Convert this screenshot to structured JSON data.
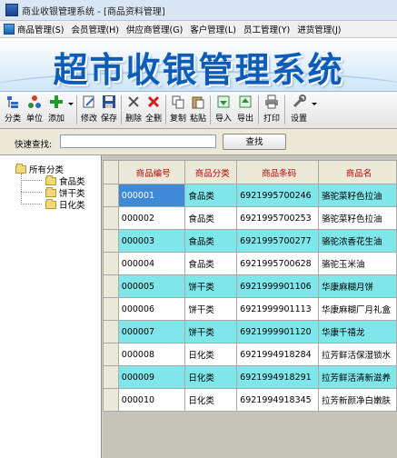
{
  "window": {
    "title": "商业收银管理系统 - [商品资料管理]"
  },
  "menu": [
    {
      "label": "商品管理(S)"
    },
    {
      "label": "会员管理(H)"
    },
    {
      "label": "供应商管理(G)"
    },
    {
      "label": "客户管理(L)"
    },
    {
      "label": "员工管理(Y)"
    },
    {
      "label": "进货管理(J)"
    }
  ],
  "banner": {
    "title": "超市收银管理系统"
  },
  "toolbar": {
    "category": "分类",
    "unit": "单位",
    "add": "添加",
    "modify": "修改",
    "save": "保存",
    "delete": "删除",
    "delete_all": "全删",
    "copy": "复制",
    "paste": "粘贴",
    "import": "导入",
    "export": "导出",
    "print": "打印",
    "settings": "设置"
  },
  "search": {
    "label": "快速查找:",
    "value": "",
    "button": "查找"
  },
  "tree": {
    "root": "所有分类",
    "children": [
      "食品类",
      "饼干类",
      "日化类"
    ]
  },
  "table": {
    "columns": [
      "商品编号",
      "商品分类",
      "商品条码",
      "商品名"
    ],
    "rows": [
      {
        "code": "000001",
        "category": "食品类",
        "barcode": "6921995700246",
        "name": "骆驼菜籽色拉油"
      },
      {
        "code": "000002",
        "category": "食品类",
        "barcode": "6921995700253",
        "name": "骆驼菜籽色拉油"
      },
      {
        "code": "000003",
        "category": "食品类",
        "barcode": "6921995700277",
        "name": "骆驼浓香花生油"
      },
      {
        "code": "000004",
        "category": "食品类",
        "barcode": "6921995700628",
        "name": "骆驼玉米油"
      },
      {
        "code": "000005",
        "category": "饼干类",
        "barcode": "6921999901106",
        "name": "华康麻糊月饼"
      },
      {
        "code": "000006",
        "category": "饼干类",
        "barcode": "6921999901113",
        "name": "华康麻糊厂月礼盒"
      },
      {
        "code": "000007",
        "category": "饼干类",
        "barcode": "6921999901120",
        "name": "华康千禧龙"
      },
      {
        "code": "000008",
        "category": "日化类",
        "barcode": "6921994918284",
        "name": "拉芳鲜活保湿锁水"
      },
      {
        "code": "000009",
        "category": "日化类",
        "barcode": "6921994918291",
        "name": "拉芳鲜活清新滋养"
      },
      {
        "code": "000010",
        "category": "日化类",
        "barcode": "6921994918345",
        "name": "拉芳新颜净白嫩肤"
      }
    ]
  }
}
